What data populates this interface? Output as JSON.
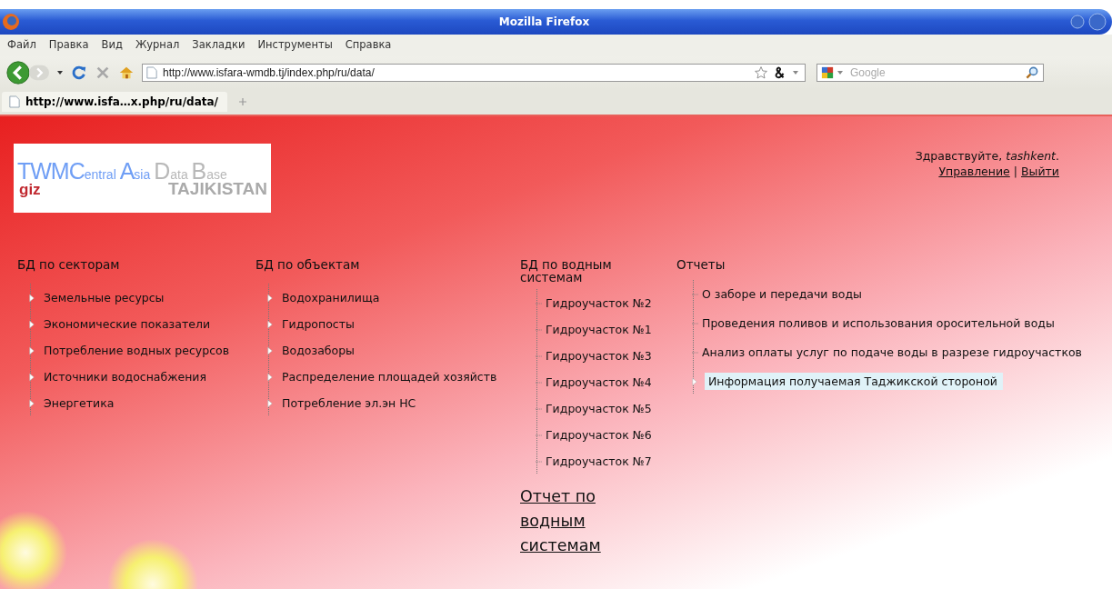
{
  "window": {
    "title": "Mozilla Firefox"
  },
  "menu": [
    "Файл",
    "Правка",
    "Вид",
    "Журнал",
    "Закладки",
    "Инструменты",
    "Справка"
  ],
  "toolbar": {
    "url": "http://www.isfara-wmdb.tj/index.php/ru/data/",
    "search": {
      "placeholder": "Google"
    }
  },
  "tabs": [
    {
      "label": "http://www.isfa…x.php/ru/data/",
      "selected": true
    }
  ],
  "page": {
    "logo": {
      "title_parts": [
        {
          "text": "TWMC",
          "kind": "big"
        },
        {
          "text": "entral ",
          "kind": "small"
        },
        {
          "text": "A",
          "kind": "big"
        },
        {
          "text": "sia ",
          "kind": "small"
        },
        {
          "text": "D",
          "kind": "biggrey"
        },
        {
          "text": "ata ",
          "kind": "smallgrey"
        },
        {
          "text": "B",
          "kind": "biggrey"
        },
        {
          "text": "ase",
          "kind": "smallgrey"
        }
      ],
      "brand": "giz",
      "country": "TAJIKISTAN"
    },
    "greeting": "Здравствуйте, *tashkent*.",
    "user_links": [
      "Управление",
      "Выйти"
    ],
    "separator": "|",
    "columns": [
      {
        "heading": "БД по секторам",
        "kind": "arrow",
        "items": [
          {
            "label": "Земельные ресурсы",
            "selected": false
          },
          {
            "label": "Экономические показатели",
            "selected": false
          },
          {
            "label": "Потребление водных ресурсов",
            "selected": false
          },
          {
            "label": "Источники водоснабжения",
            "selected": false
          },
          {
            "label": "Энергетика",
            "selected": false
          }
        ]
      },
      {
        "heading": "БД по объектам",
        "kind": "arrow",
        "items": [
          {
            "label": "Водохранилища",
            "selected": false
          },
          {
            "label": "Гидропосты",
            "selected": false
          },
          {
            "label": "Водозаборы",
            "selected": false
          },
          {
            "label": "Распределение площадей хозяйств",
            "selected": false
          },
          {
            "label": "Потребление эл.эн НС",
            "selected": false
          }
        ]
      },
      {
        "heading": "БД по водным системам",
        "kind": "tree",
        "items": [
          {
            "label": "Гидроучасток №2",
            "selected": false
          },
          {
            "label": "Гидроучасток №1",
            "selected": false
          },
          {
            "label": "Гидроучасток №3",
            "selected": false
          },
          {
            "label": "Гидроучасток №4",
            "selected": false
          },
          {
            "label": "Гидроучасток №5",
            "selected": false
          },
          {
            "label": "Гидроучасток №6",
            "selected": false
          },
          {
            "label": "Гидроучасток №7",
            "selected": false
          }
        ],
        "report_link": "Отчет по водным системам"
      },
      {
        "heading": "Отчеты",
        "kind": "tree",
        "items": [
          {
            "label": "О заборе и передачи воды",
            "selected": false
          },
          {
            "label": "Проведения поливов и использования оросительной воды",
            "selected": false
          },
          {
            "label": "Анализ оплаты услуг по подаче воды в разрезе гидроучастков",
            "selected": false
          },
          {
            "label": "Информация получаемая Таджикской стороной",
            "selected": true
          }
        ]
      }
    ]
  }
}
